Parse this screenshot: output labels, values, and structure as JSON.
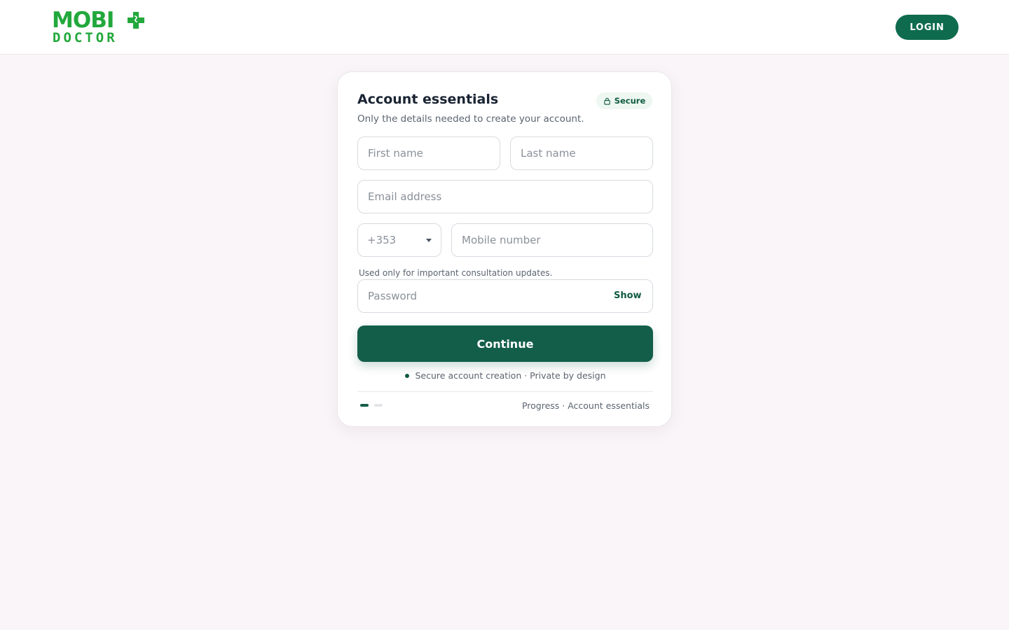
{
  "header": {
    "logo": {
      "line1": "MOBI",
      "line2": "DOCTOR",
      "brand_color": "#22a83c",
      "icon": "medical-cross-icon"
    },
    "login_label": "LOGIN"
  },
  "card": {
    "title": "Account essentials",
    "badge": {
      "label": "Secure",
      "icon": "lock-icon"
    },
    "subtitle": "Only the details needed to create your account.",
    "fields": {
      "first_name": {
        "placeholder": "First name",
        "value": ""
      },
      "last_name": {
        "placeholder": "Last name",
        "value": ""
      },
      "email": {
        "placeholder": "Email address",
        "value": ""
      },
      "country_code": {
        "selected": "+353"
      },
      "mobile": {
        "placeholder": "Mobile number",
        "value": ""
      },
      "mobile_helper": "Used only for important consultation updates.",
      "password": {
        "placeholder": "Password",
        "value": "",
        "toggle_label": "Show"
      }
    },
    "continue_label": "Continue",
    "trust_text": "Secure account creation · Private by design",
    "progress": {
      "current_step": 1,
      "total_steps": 2,
      "label": "Progress · Account essentials"
    }
  },
  "colors": {
    "primary": "#135e49",
    "login_button": "#0f6b4e",
    "page_background": "#faf5f8"
  }
}
